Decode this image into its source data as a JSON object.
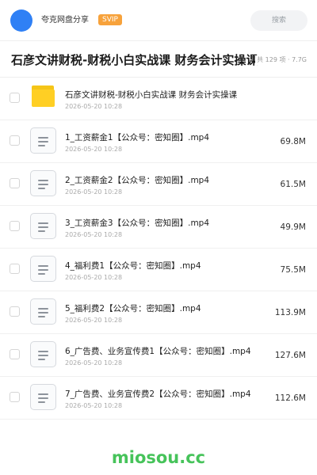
{
  "header": {
    "owner": "夸克网盘分享",
    "badge": "SVIP",
    "search_label": "搜索"
  },
  "share": {
    "title": "石彦文讲财税-财税小白实战课 财务会计实操课",
    "count": "共 129 项 · 7.7G"
  },
  "files": [
    {
      "type": "folder",
      "name": "石彦文讲财税-财税小白实战课 财务会计实操课",
      "date": "2026-05-20 10:28",
      "size": ""
    },
    {
      "type": "file",
      "name": "1_工资薪金1【公众号：密知圈】.mp4",
      "date": "2026-05-20 10:28",
      "size": "69.8M"
    },
    {
      "type": "file",
      "name": "2_工资薪金2【公众号：密知圈】.mp4",
      "date": "2026-05-20 10:28",
      "size": "61.5M"
    },
    {
      "type": "file",
      "name": "3_工资薪金3【公众号：密知圈】.mp4",
      "date": "2026-05-20 10:28",
      "size": "49.9M"
    },
    {
      "type": "file",
      "name": "4_福利费1【公众号：密知圈】.mp4",
      "date": "2026-05-20 10:28",
      "size": "75.5M"
    },
    {
      "type": "file",
      "name": "5_福利费2【公众号：密知圈】.mp4",
      "date": "2026-05-20 10:28",
      "size": "113.9M"
    },
    {
      "type": "file",
      "name": "6_广告费、业务宣传费1【公众号：密知圈】.mp4",
      "date": "2026-05-20 10:28",
      "size": "127.6M"
    },
    {
      "type": "file",
      "name": "7_广告费、业务宣传费2【公众号：密知圈】.mp4",
      "date": "2026-05-20 10:28",
      "size": "112.6M"
    }
  ],
  "watermark": "miosou.cc",
  "colors": {
    "avatar": "#2f80f5",
    "svip_badge": "#f7a23b",
    "folder": "#ffcf24",
    "watermark": "#46c35a"
  }
}
